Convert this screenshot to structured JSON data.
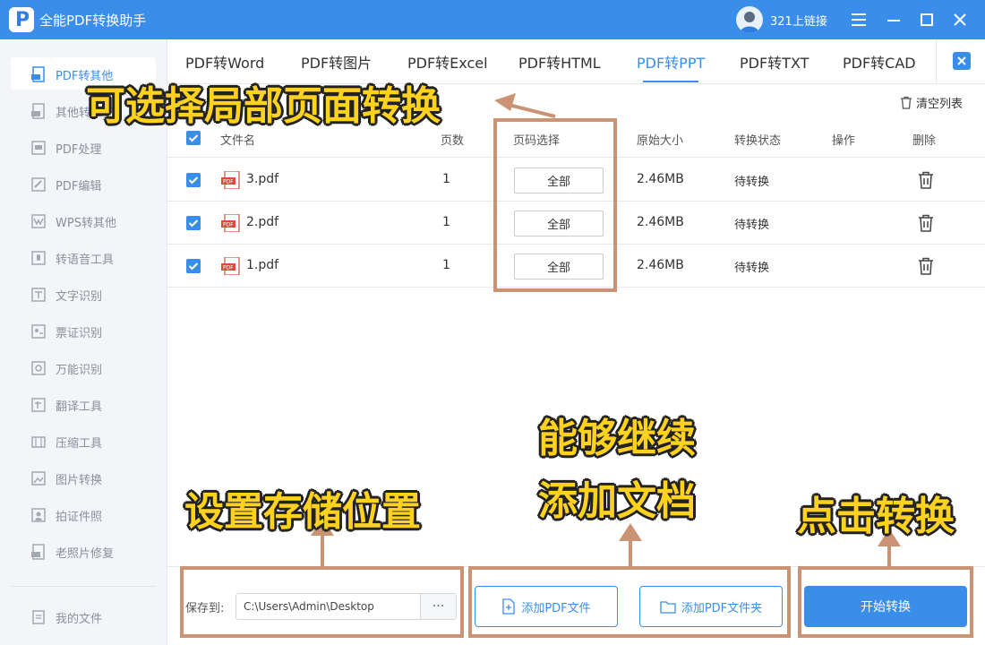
{
  "app": {
    "title": "全能PDF转换助手",
    "logo_letter": "P",
    "user_name": "321上链接"
  },
  "sidebar": {
    "items": [
      {
        "label": "PDF转其他",
        "icon": "pdf-file-icon",
        "active": true
      },
      {
        "label": "其他转PDF",
        "icon": "pdf-file-icon"
      },
      {
        "label": "PDF处理",
        "icon": "pdf-process-icon"
      },
      {
        "label": "PDF编辑",
        "icon": "pdf-edit-icon"
      },
      {
        "label": "WPS转其他",
        "icon": "wps-icon"
      },
      {
        "label": "转语音工具",
        "icon": "voice-icon"
      },
      {
        "label": "文字识别",
        "icon": "text-ocr-icon"
      },
      {
        "label": "票证识别",
        "icon": "ticket-ocr-icon"
      },
      {
        "label": "万能识别",
        "icon": "universal-ocr-icon"
      },
      {
        "label": "翻译工具",
        "icon": "translate-icon"
      },
      {
        "label": "压缩工具",
        "icon": "compress-icon"
      },
      {
        "label": "图片转换",
        "icon": "image-convert-icon"
      },
      {
        "label": "拍证件照",
        "icon": "id-photo-icon"
      },
      {
        "label": "老照片修复",
        "icon": "photo-restore-icon"
      }
    ],
    "my_files": "我的文件"
  },
  "tabs": [
    {
      "label": "PDF转Word"
    },
    {
      "label": "PDF转图片"
    },
    {
      "label": "PDF转Excel"
    },
    {
      "label": "PDF转HTML"
    },
    {
      "label": "PDF转PPT",
      "active": true
    },
    {
      "label": "PDF转TXT"
    },
    {
      "label": "PDF转CAD"
    }
  ],
  "toolbar": {
    "clear_list": "清空列表"
  },
  "table": {
    "headers": {
      "filename": "文件名",
      "pages": "页数",
      "page_select": "页码选择",
      "size": "原始大小",
      "status": "转换状态",
      "action": "操作",
      "delete": "删除"
    },
    "rows": [
      {
        "name": "3.pdf",
        "pages": "1",
        "page_select": "全部",
        "size": "2.46MB",
        "status": "待转换"
      },
      {
        "name": "2.pdf",
        "pages": "1",
        "page_select": "全部",
        "size": "2.46MB",
        "status": "待转换"
      },
      {
        "name": "1.pdf",
        "pages": "1",
        "page_select": "全部",
        "size": "2.46MB",
        "status": "待转换"
      }
    ]
  },
  "bottom": {
    "save_label": "保存到:",
    "save_path": "C:\\Users\\Admin\\Desktop",
    "more": "···",
    "add_file": "添加PDF文件",
    "add_folder": "添加PDF文件夹",
    "start": "开始转换"
  },
  "annotations": {
    "page_select": "可选择局部页面转换",
    "add_docs_line1": "能够继续",
    "add_docs_line2": "添加文档",
    "save_location": "设置存储位置",
    "convert": "点击转换"
  },
  "colors": {
    "accent": "#3a8eea",
    "annotation_text": "#ffd21f",
    "annotation_box": "#c99374"
  }
}
